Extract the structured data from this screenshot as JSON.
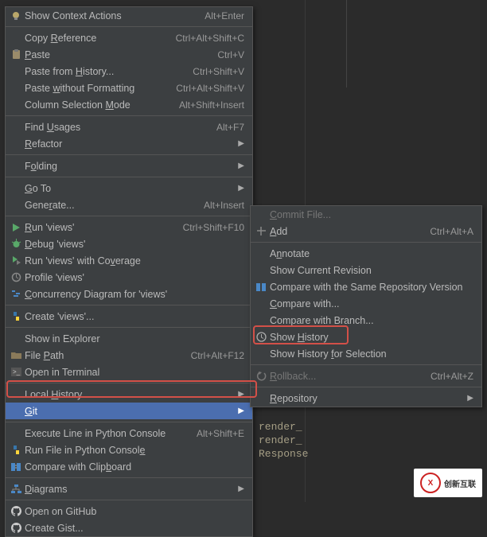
{
  "menu1": {
    "context_actions": {
      "label": "Show Context Actions",
      "shortcut": "Alt+Enter"
    },
    "copy_ref": {
      "label": "Copy Reference",
      "shortcut": "Ctrl+Alt+Shift+C"
    },
    "paste": {
      "label": "Paste",
      "shortcut": "Ctrl+V"
    },
    "paste_history": {
      "label": "Paste from History...",
      "shortcut": "Ctrl+Shift+V"
    },
    "paste_no_fmt": {
      "label": "Paste without Formatting",
      "shortcut": "Ctrl+Alt+Shift+V"
    },
    "col_sel": {
      "label": "Column Selection Mode",
      "shortcut": "Alt+Shift+Insert"
    },
    "find_usages": {
      "label": "Find Usages",
      "shortcut": "Alt+F7"
    },
    "refactor": {
      "label": "Refactor"
    },
    "folding": {
      "label": "Folding"
    },
    "goto": {
      "label": "Go To"
    },
    "generate": {
      "label": "Generate...",
      "shortcut": "Alt+Insert"
    },
    "run": {
      "label": "Run 'views'",
      "shortcut": "Ctrl+Shift+F10"
    },
    "debug": {
      "label": "Debug 'views'"
    },
    "coverage": {
      "label": "Run 'views' with Coverage"
    },
    "profile": {
      "label": "Profile 'views'"
    },
    "concurrency": {
      "label": "Concurrency Diagram for 'views'"
    },
    "create": {
      "label": "Create 'views'..."
    },
    "show_explorer": {
      "label": "Show in Explorer"
    },
    "file_path": {
      "label": "File Path",
      "shortcut": "Ctrl+Alt+F12"
    },
    "open_term": {
      "label": "Open in Terminal"
    },
    "local_hist": {
      "label": "Local History"
    },
    "git": {
      "label": "Git"
    },
    "exec_line": {
      "label": "Execute Line in Python Console",
      "shortcut": "Alt+Shift+E"
    },
    "run_file": {
      "label": "Run File in Python Console"
    },
    "compare_clip": {
      "label": "Compare with Clipboard"
    },
    "diagrams": {
      "label": "Diagrams"
    },
    "open_github": {
      "label": "Open on GitHub"
    },
    "create_gist": {
      "label": "Create Gist..."
    }
  },
  "menu2": {
    "commit": {
      "label": "Commit File..."
    },
    "add": {
      "label": "Add",
      "shortcut": "Ctrl+Alt+A"
    },
    "annotate": {
      "label": "Annotate"
    },
    "show_rev": {
      "label": "Show Current Revision"
    },
    "cmp_same": {
      "label": "Compare with the Same Repository Version"
    },
    "cmp_with": {
      "label": "Compare with..."
    },
    "cmp_branch": {
      "label": "Compare with Branch..."
    },
    "show_hist": {
      "label": "Show History"
    },
    "show_hist_sel": {
      "label": "Show History for Selection"
    },
    "rollback": {
      "label": "Rollback...",
      "shortcut": "Ctrl+Alt+Z"
    },
    "repo": {
      "label": "Repository"
    }
  },
  "code_lines": [
    "render_",
    "render_",
    "Response"
  ],
  "watermark": {
    "letter": "X",
    "text": "创新互联"
  }
}
